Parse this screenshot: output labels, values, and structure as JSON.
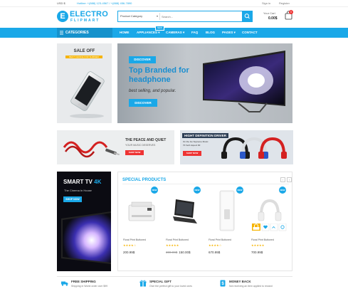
{
  "topbar": {
    "currency": "USD $",
    "hotline": "Hotline: +(888) 123-4567 / +(888) 456-7890",
    "signin": "Sign in",
    "register": "Register"
  },
  "logo": {
    "mark": "E",
    "name": "ELECTRO",
    "sub": "FLIPMART"
  },
  "search": {
    "category": "Product Category",
    "placeholder": "Search..."
  },
  "cart": {
    "label": "Your Cart",
    "amount": "0.00$",
    "count": "0"
  },
  "nav": {
    "categories": "CATEGORIES",
    "new_tag": "NEW",
    "items": [
      "HOME",
      "APPLIANCES ▾",
      "CAMERAS ▾",
      "FAQ",
      "BLOG",
      "PAGES ▾",
      "CONTACT"
    ]
  },
  "promo_sale": {
    "title": "SALE OFF",
    "subtitle": "BEST CHOICE FOR SUMMER"
  },
  "hero": {
    "tag": "DISCOVER",
    "headline": "Top Branded for headphone",
    "subline": "best selling, and popular.",
    "button": "DISCOVER"
  },
  "promo_quiet": {
    "title": "THE PEACE AND QUIET",
    "subtitle": "YOUR MUSIC DESERVES",
    "button": "SHOP NOW"
  },
  "promo_hd": {
    "title": "HIGHT DEFINITION DRIVER",
    "line1": "On the Go Supreme Music",
    "line2": "70 Verb Aspect 90",
    "button": "SHOP NOW"
  },
  "promo_tv": {
    "title": "SMART TV",
    "title_accent": "4K",
    "subtitle": "The Cinema In House",
    "button": "SHOP NOW"
  },
  "special": {
    "title": "SPECIAL PRODUCTS",
    "prev": "‹",
    "next": "›",
    "products": [
      {
        "badge": "NEW",
        "name": "Floral Print Buttoned",
        "stars": "★★★★☆",
        "old_price": "",
        "price": "200.99$",
        "icon": "printer-icon"
      },
      {
        "badge": "NEW",
        "name": "Floral Print Buttoned",
        "stars": "★★★★★",
        "old_price": "300.99$",
        "price": "150.00$",
        "icon": "laptop-icon"
      },
      {
        "badge": "NEW",
        "name": "Floral Print Buttoned",
        "stars": "★★★★☆",
        "old_price": "",
        "price": "670.99$",
        "icon": "speaker-icon"
      },
      {
        "badge": "NEW",
        "name": "Floral Print Buttoned",
        "stars": "★★★★★",
        "old_price": "",
        "price": "700.99$",
        "icon": "headphones-icon"
      }
    ]
  },
  "features": [
    {
      "title": "FREE SHIPPING",
      "desc": "Shipping in World order over $99",
      "icon": "truck-icon"
    },
    {
      "title": "SPECIAL GIFT",
      "desc": "Give the perfect gift to your loved ones",
      "icon": "gift-icon"
    },
    {
      "title": "MONEY BACK",
      "desc": "Not receiving an item applied to reward",
      "icon": "money-icon"
    }
  ],
  "colors": {
    "accent": "#1aa8e8",
    "sale": "#f6b400",
    "shop_button": "#e33333"
  }
}
